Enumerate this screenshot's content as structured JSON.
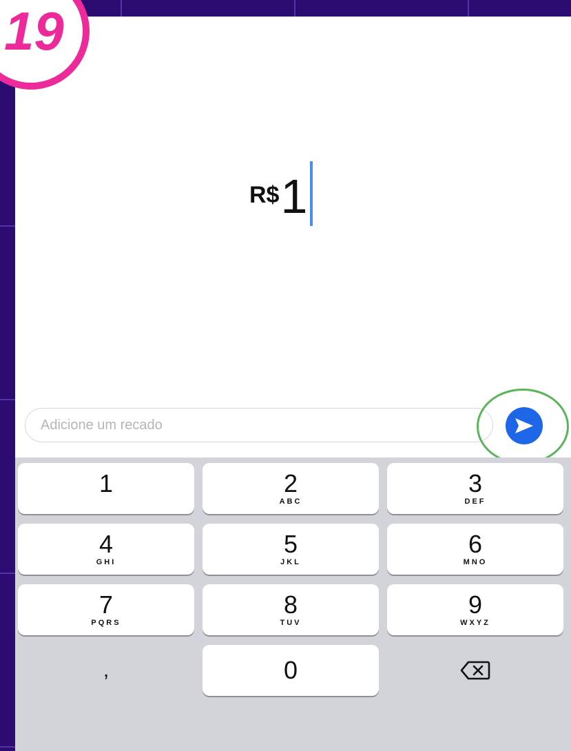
{
  "step_badge": "19",
  "amount": {
    "currency": "R$",
    "value": "1"
  },
  "note": {
    "placeholder": "Adicione um recado",
    "value": ""
  },
  "colors": {
    "accent": "#1e66e8",
    "badge": "#ec2a9a",
    "highlight_ring": "#5ab45a",
    "background": "#2b0d72"
  },
  "keypad": {
    "keys": [
      {
        "digit": "1",
        "letters": ""
      },
      {
        "digit": "2",
        "letters": "ABC"
      },
      {
        "digit": "3",
        "letters": "DEF"
      },
      {
        "digit": "4",
        "letters": "GHI"
      },
      {
        "digit": "5",
        "letters": "JKL"
      },
      {
        "digit": "6",
        "letters": "MNO"
      },
      {
        "digit": "7",
        "letters": "PQRS"
      },
      {
        "digit": "8",
        "letters": "TUV"
      },
      {
        "digit": "9",
        "letters": "WXYZ"
      },
      {
        "digit": ",",
        "letters": ""
      },
      {
        "digit": "0",
        "letters": ""
      },
      {
        "digit": "",
        "letters": "",
        "icon": "backspace-icon"
      }
    ]
  },
  "send_button": {
    "icon": "send-icon"
  }
}
